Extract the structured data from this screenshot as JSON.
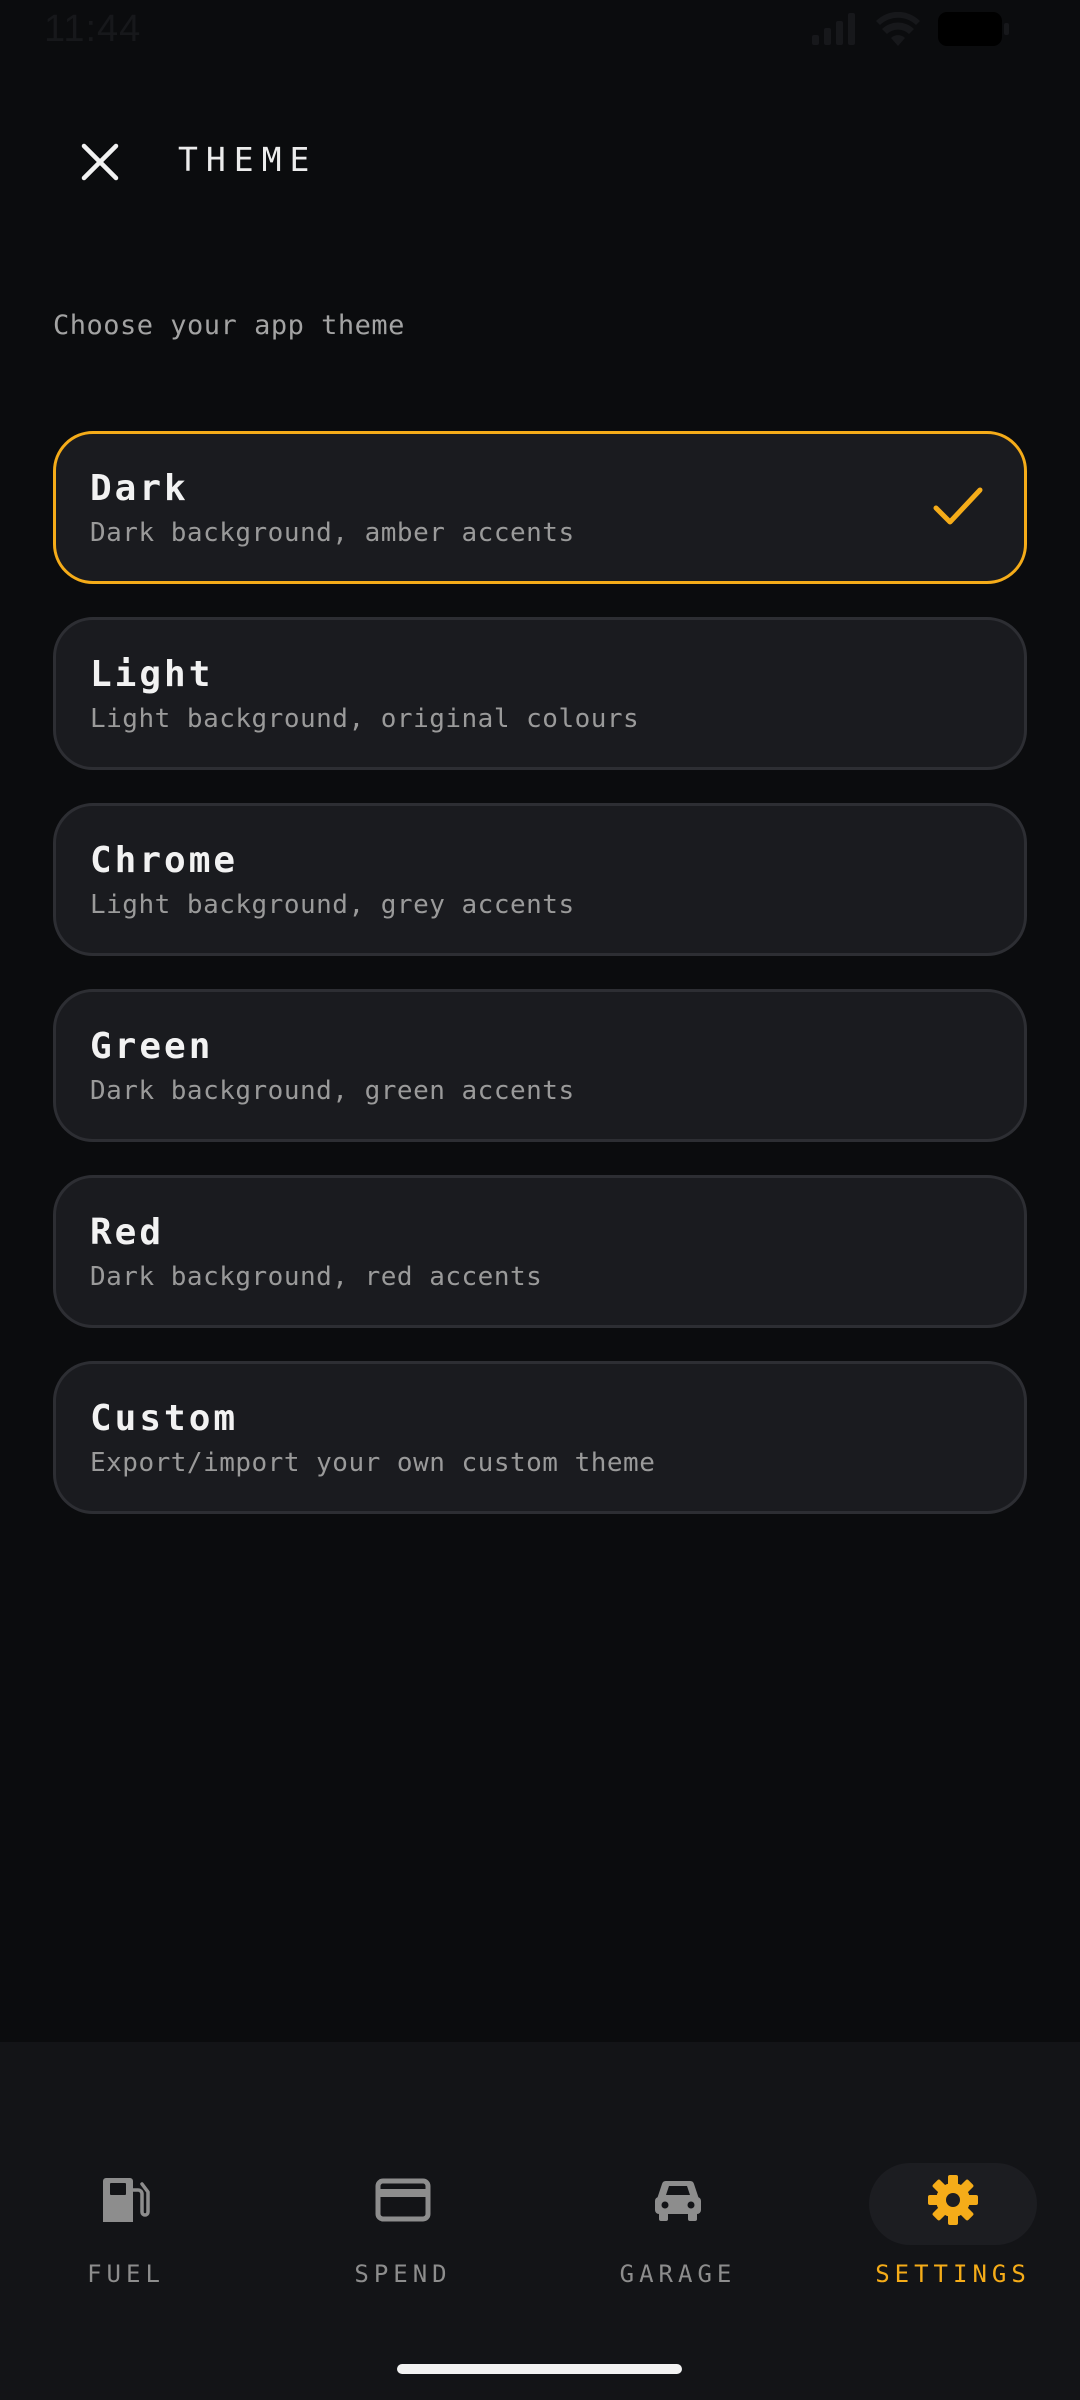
{
  "status_bar": {
    "time": "11:44"
  },
  "header": {
    "title": "THEME",
    "close_icon": "close-icon"
  },
  "subtitle": "Choose your app theme",
  "themes": [
    {
      "name": "Dark",
      "description": "Dark background, amber accents",
      "selected": true
    },
    {
      "name": "Light",
      "description": "Light background, original colours",
      "selected": false
    },
    {
      "name": "Chrome",
      "description": "Light background, grey accents",
      "selected": false
    },
    {
      "name": "Green",
      "description": "Dark background, green accents",
      "selected": false
    },
    {
      "name": "Red",
      "description": "Dark background, red accents",
      "selected": false
    },
    {
      "name": "Custom",
      "description": "Export/import your own custom theme",
      "selected": false
    }
  ],
  "bottom_nav": {
    "items": [
      {
        "label": "FUEL",
        "icon": "fuel-pump-icon",
        "active": false
      },
      {
        "label": "SPEND",
        "icon": "credit-card-icon",
        "active": false
      },
      {
        "label": "GARAGE",
        "icon": "car-icon",
        "active": false
      },
      {
        "label": "SETTINGS",
        "icon": "gear-icon",
        "active": true
      }
    ]
  },
  "colors": {
    "accent": "#f5ac19",
    "background": "#0b0c0e",
    "card": "#1a1b1f",
    "card_border": "#2d2e33",
    "muted_text": "#9a9a9a",
    "nav_background": "#131417"
  }
}
